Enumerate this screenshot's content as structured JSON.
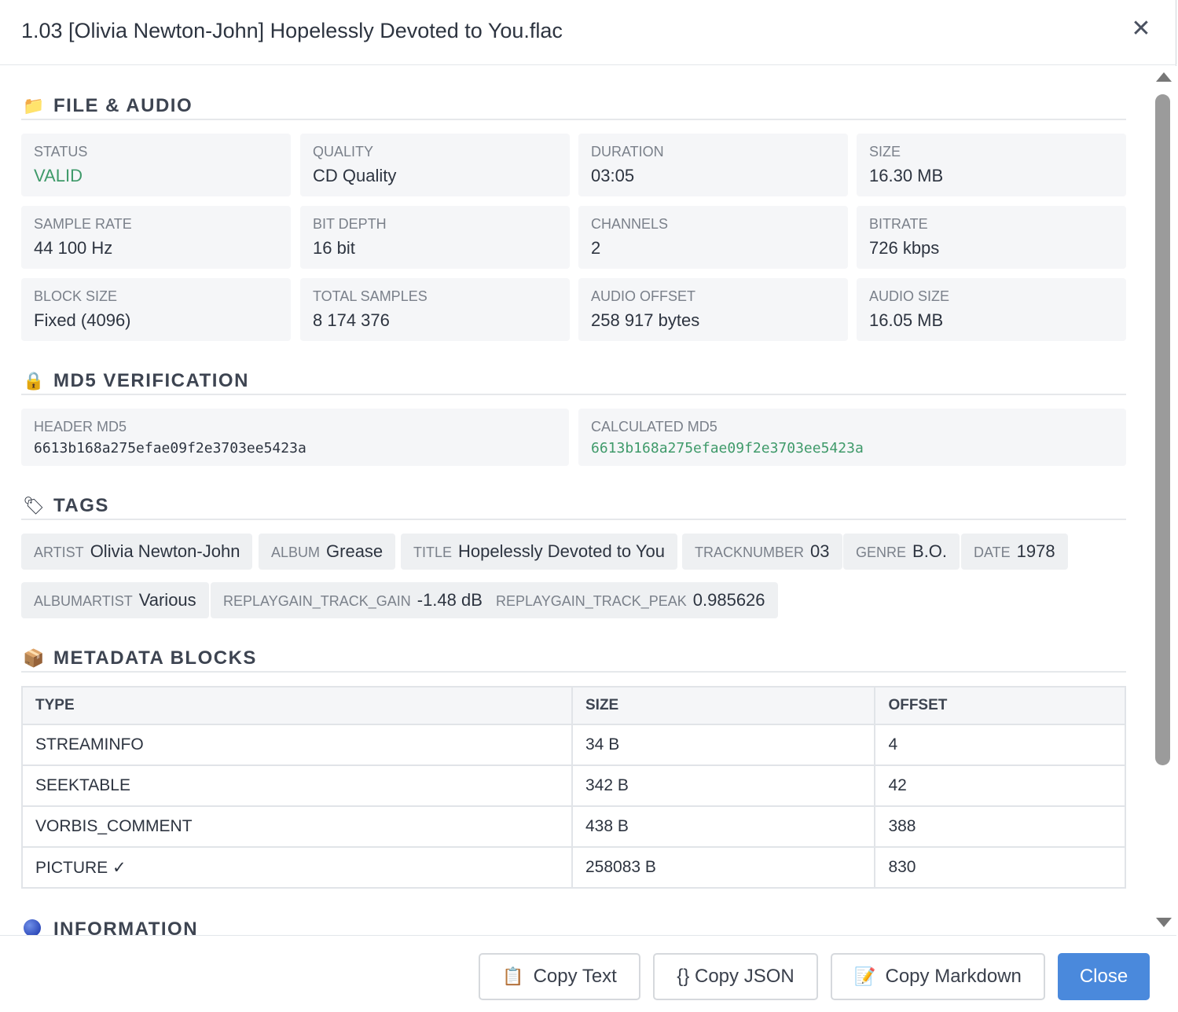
{
  "dialog": {
    "title": "1.03 [Olivia Newton-John] Hopelessly Devoted to You.flac",
    "close_glyph": "✕"
  },
  "sections": {
    "file_audio": {
      "icon": "folder-icon",
      "glyph": "📁",
      "title": "FILE & AUDIO"
    },
    "md5": {
      "icon": "lock-icon",
      "glyph": "🔒",
      "title": "MD5 VERIFICATION"
    },
    "tags": {
      "icon": "tag-icon",
      "glyph": "🏷",
      "title": "TAGS"
    },
    "blocks": {
      "icon": "package-icon",
      "glyph": "📦",
      "title": "METADATA BLOCKS"
    },
    "information": {
      "icon": "globe-icon",
      "title": "INFORMATION"
    }
  },
  "file_audio": [
    {
      "label": "STATUS",
      "value": "VALID"
    },
    {
      "label": "QUALITY",
      "value": "CD Quality"
    },
    {
      "label": "DURATION",
      "value": "03:05"
    },
    {
      "label": "SIZE",
      "value": "16.30 MB"
    },
    {
      "label": "SAMPLE RATE",
      "value": "44 100 Hz"
    },
    {
      "label": "BIT DEPTH",
      "value": "16 bit"
    },
    {
      "label": "CHANNELS",
      "value": "2"
    },
    {
      "label": "BITRATE",
      "value": "726 kbps"
    },
    {
      "label": "BLOCK SIZE",
      "value": "Fixed (4096)"
    },
    {
      "label": "TOTAL SAMPLES",
      "value": "8 174 376"
    },
    {
      "label": "AUDIO OFFSET",
      "value": "258 917 bytes"
    },
    {
      "label": "AUDIO SIZE",
      "value": "16.05 MB"
    }
  ],
  "md5": {
    "header": {
      "label": "HEADER MD5",
      "value": "6613b168a275efae09f2e3703ee5423a"
    },
    "calculated": {
      "label": "CALCULATED MD5",
      "value": "6613b168a275efae09f2e3703ee5423a"
    }
  },
  "tags": [
    {
      "key": "ARTIST",
      "value": "Olivia Newton-John"
    },
    {
      "key": "ALBUM",
      "value": "Grease"
    },
    {
      "key": "TITLE",
      "value": "Hopelessly Devoted to You"
    },
    {
      "key": "TRACKNUMBER",
      "value": "03"
    },
    {
      "key": "GENRE",
      "value": "B.O."
    },
    {
      "key": "DATE",
      "value": "1978"
    },
    {
      "key": "ALBUMARTIST",
      "value": "Various"
    },
    {
      "key": "REPLAYGAIN_TRACK_GAIN",
      "value": "-1.48 dB"
    },
    {
      "key": "REPLAYGAIN_TRACK_PEAK",
      "value": "0.985626"
    }
  ],
  "blocks": {
    "headers": [
      "TYPE",
      "SIZE",
      "OFFSET"
    ],
    "rows": [
      [
        "STREAMINFO",
        "34 B",
        "4"
      ],
      [
        "SEEKTABLE",
        "342 B",
        "42"
      ],
      [
        "VORBIS_COMMENT",
        "438 B",
        "388"
      ],
      [
        "PICTURE ✓",
        "258083 B",
        "830"
      ]
    ]
  },
  "footer": {
    "copy_text": {
      "icon": "clipboard-icon",
      "glyph": "📋",
      "label": "Copy Text"
    },
    "copy_json": {
      "label": "{} Copy JSON"
    },
    "copy_markdown": {
      "icon": "memo-icon",
      "glyph": "📝",
      "label": "Copy Markdown"
    },
    "close": {
      "label": "Close"
    }
  },
  "colors": {
    "valid": "#3f9a6a",
    "primary": "#4a89dc"
  }
}
